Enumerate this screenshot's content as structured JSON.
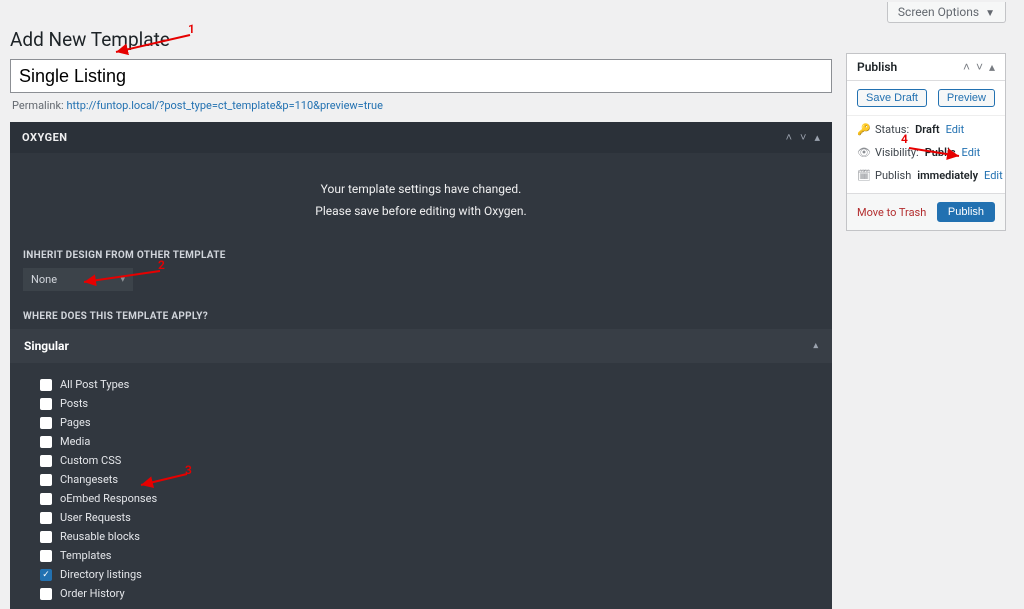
{
  "screen_options_label": "Screen Options",
  "page_title": "Add New Template",
  "title_input_value": "Single Listing",
  "permalink": {
    "label": "Permalink:",
    "url_text": "http://funtop.local/?post_type=ct_template&p=110&preview=true"
  },
  "oxygen": {
    "panel_title": "OXYGEN",
    "notice_line1": "Your template settings have changed.",
    "notice_line2": "Please save before editing with Oxygen.",
    "inherit_label": "INHERIT DESIGN FROM OTHER TEMPLATE",
    "inherit_value": "None",
    "apply_label": "WHERE DOES THIS TEMPLATE APPLY?",
    "accordion_title": "Singular",
    "checkboxes": [
      {
        "label": "All Post Types",
        "checked": false
      },
      {
        "label": "Posts",
        "checked": false
      },
      {
        "label": "Pages",
        "checked": false
      },
      {
        "label": "Media",
        "checked": false
      },
      {
        "label": "Custom CSS",
        "checked": false
      },
      {
        "label": "Changesets",
        "checked": false
      },
      {
        "label": "oEmbed Responses",
        "checked": false
      },
      {
        "label": "User Requests",
        "checked": false
      },
      {
        "label": "Reusable blocks",
        "checked": false
      },
      {
        "label": "Templates",
        "checked": false
      },
      {
        "label": "Directory listings",
        "checked": true
      },
      {
        "label": "Order History",
        "checked": false
      }
    ]
  },
  "publish": {
    "box_title": "Publish",
    "save_draft": "Save Draft",
    "preview": "Preview",
    "status_label": "Status:",
    "status_value": "Draft",
    "visibility_label": "Visibility:",
    "visibility_value": "Public",
    "schedule_label": "Publish",
    "schedule_value": "immediately",
    "edit_link": "Edit",
    "trash_link": "Move to Trash",
    "publish_button": "Publish"
  },
  "annotations": {
    "n1": "1",
    "n2": "2",
    "n3": "3",
    "n4": "4"
  }
}
